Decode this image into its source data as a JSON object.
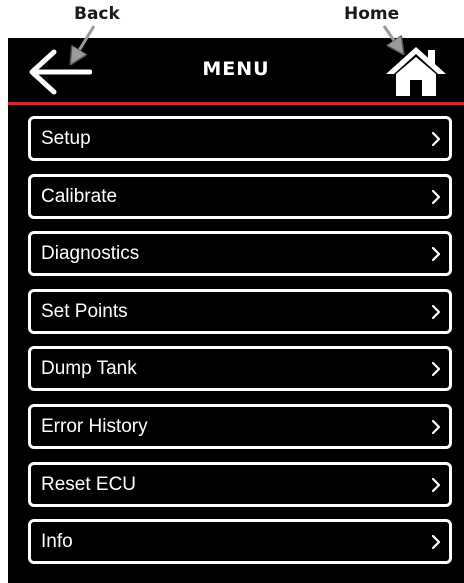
{
  "callouts": {
    "back": "Back",
    "home": "Home"
  },
  "header": {
    "title": "MENU",
    "back_icon": "arrow-left-icon",
    "home_icon": "house-icon"
  },
  "menu": {
    "items": [
      {
        "label": "Setup"
      },
      {
        "label": "Calibrate"
      },
      {
        "label": "Diagnostics"
      },
      {
        "label": "Set Points"
      },
      {
        "label": "Dump Tank"
      },
      {
        "label": "Error History"
      },
      {
        "label": "Reset ECU"
      },
      {
        "label": "Info"
      }
    ]
  },
  "colors": {
    "background": "#000000",
    "accent_rule": "#d6262e",
    "text": "#ffffff"
  }
}
